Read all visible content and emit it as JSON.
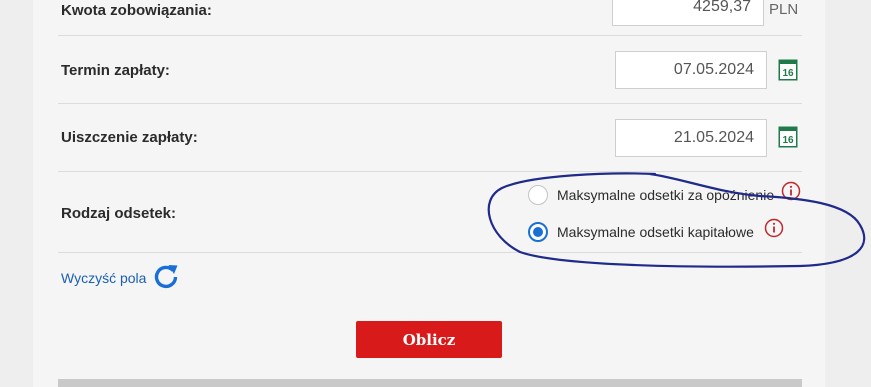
{
  "form": {
    "amount": {
      "label": "Kwota zobowiązania:",
      "value": "4259,37",
      "unit": "PLN"
    },
    "due_date": {
      "label": "Termin zapłaty:",
      "value": "07.05.2024",
      "calendar_icon_text": "16"
    },
    "payment_date": {
      "label": "Uiszczenie zapłaty:",
      "value": "21.05.2024",
      "calendar_icon_text": "16"
    },
    "interest_type": {
      "label": "Rodzaj odsetek:",
      "options": [
        {
          "label": "Maksymalne odsetki za opóźnienie",
          "selected": false
        },
        {
          "label": "Maksymalne odsetki kapitałowe",
          "selected": true
        }
      ]
    },
    "clear_label": "Wyczyść pola",
    "submit_label": "Oblicz"
  },
  "colors": {
    "accent_blue": "#1a6fd6",
    "button_red": "#d81a1a",
    "calendar_green": "#1f7a4a",
    "info_red": "#c0282d",
    "annotation_ink": "#1f2a8a"
  }
}
